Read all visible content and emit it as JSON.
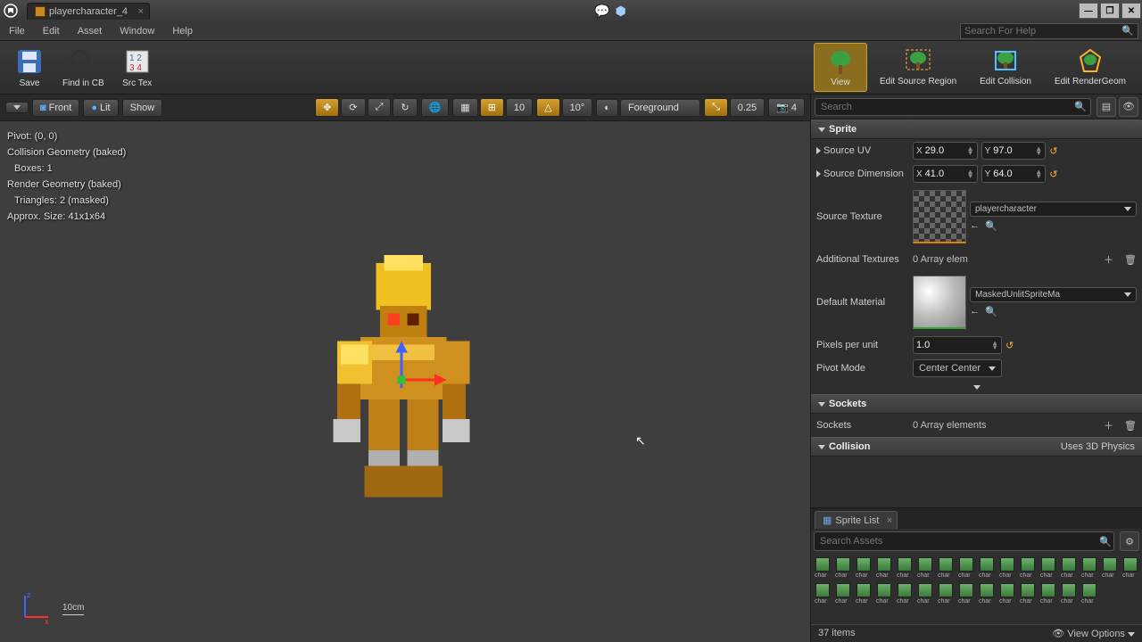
{
  "titlebar": {
    "tab_title": "playercharacter_4"
  },
  "menu": {
    "file": "File",
    "edit": "Edit",
    "asset": "Asset",
    "window": "Window",
    "help": "Help",
    "search_placeholder": "Search For Help"
  },
  "toolbar": {
    "save": "Save",
    "find_in_cb": "Find in CB",
    "src_tex": "Src Tex"
  },
  "modes": {
    "view": "View",
    "edit_source_region": "Edit Source Region",
    "edit_collision": "Edit Collision",
    "edit_rendergeom": "Edit RenderGeom"
  },
  "vp_toolbar": {
    "front": "Front",
    "lit": "Lit",
    "show": "Show",
    "grid_val": "10",
    "angle_val": "10°",
    "layer": "Foreground",
    "scale_val": "0.25",
    "cam_val": "4"
  },
  "vp_info": {
    "pivot": "Pivot: (0, 0)",
    "collision": "Collision Geometry (baked)",
    "boxes": "Boxes: 1",
    "render": "Render Geometry (baked)",
    "tris": "Triangles: 2 (masked)",
    "size": "Approx. Size: 41x1x64",
    "scale": "10cm"
  },
  "details": {
    "search_placeholder": "Search",
    "cat_sprite": "Sprite",
    "source_uv": "Source UV",
    "uv_x": "29.0",
    "uv_y": "97.0",
    "source_dim": "Source Dimension",
    "dim_x": "41.0",
    "dim_y": "64.0",
    "source_tex": "Source Texture",
    "tex_name": "playercharacter",
    "addl_tex": "Additional Textures",
    "addl_val": "0 Array elem",
    "def_mat": "Default Material",
    "mat_name": "MaskedUnlitSpriteMa",
    "ppu": "Pixels per unit",
    "ppu_val": "1.0",
    "pivot_mode": "Pivot Mode",
    "pivot_val": "Center Center",
    "cat_sockets": "Sockets",
    "sockets": "Sockets",
    "sockets_val": "0 Array elements",
    "cat_collision": "Collision",
    "collision_note": "Uses 3D Physics"
  },
  "sprite_list": {
    "tab": "Sprite List",
    "search_placeholder": "Search Assets",
    "count": "37 items",
    "view_options": "View Options",
    "item_prefix": "char"
  }
}
